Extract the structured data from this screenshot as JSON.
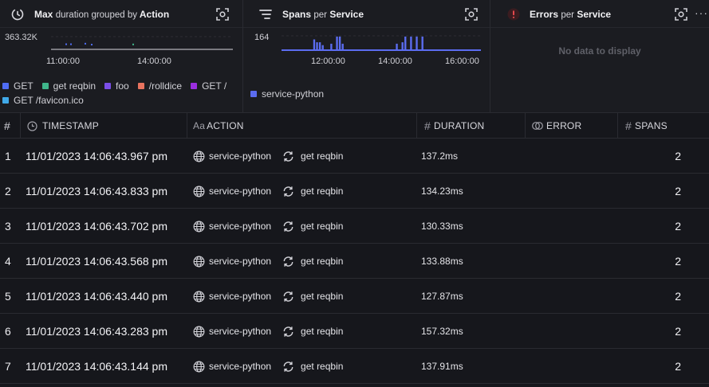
{
  "panels": [
    {
      "title_bold": "Max",
      "title_light": "duration grouped by",
      "title_bold2": "Action",
      "chart_data": {
        "type": "scatter",
        "title": "Max duration grouped by Action",
        "y_tick_labels": [
          "363.32K"
        ],
        "x_tick_labels": [
          "11:00:00",
          "14:00:00"
        ],
        "series": [
          {
            "name": "GET",
            "color": "#4f6df5",
            "points": [
              [
                0.0,
                0.12
              ],
              [
                0.03,
                0.12
              ],
              [
                0.12,
                0.18
              ],
              [
                0.16,
                0.08
              ]
            ]
          },
          {
            "name": "get reqbin",
            "color": "#3fb68b",
            "points": [
              [
                0.42,
                0.1
              ]
            ]
          },
          {
            "name": "foo",
            "color": "#7b4ee8",
            "points": []
          },
          {
            "name": "/rolldice",
            "color": "#e8735f",
            "points": []
          },
          {
            "name": "GET /",
            "color": "#9b2ee0",
            "points": []
          },
          {
            "name": "GET /favicon.ico",
            "color": "#40a9e8",
            "points": []
          }
        ],
        "grid": true,
        "legend": "bottom"
      }
    },
    {
      "title_bold": "Spans",
      "title_light": "per",
      "title_bold2": "Service",
      "chart_data": {
        "type": "bar",
        "title": "Spans per Service",
        "y_tick_labels": [
          "164"
        ],
        "x_tick_labels": [
          "12:00:00",
          "14:00:00",
          "16:00:00"
        ],
        "series": [
          {
            "name": "service-python",
            "color": "#5b6cf0",
            "values": [
              0,
              0,
              0,
              0,
              0,
              0,
              0,
              0,
              0,
              0,
              0,
              0.75,
              0.55,
              0.55,
              0.35,
              0.0,
              0.0,
              0.45,
              0.0,
              0.95,
              0.95,
              0.45,
              0,
              0,
              0,
              0,
              0,
              0,
              0,
              0,
              0,
              0,
              0,
              0,
              0,
              0,
              0,
              0,
              0,
              0.0,
              0.45,
              0,
              0.55,
              0.95,
              0,
              0.95,
              0,
              0.95,
              0,
              0.95,
              0,
              0,
              0,
              0,
              0,
              0,
              0,
              0,
              0,
              0,
              0,
              0,
              0,
              0,
              0,
              0,
              0,
              0,
              0,
              0
            ]
          }
        ],
        "grid": true,
        "legend": "bottom"
      }
    },
    {
      "title_bold": "Errors",
      "title_light": "per",
      "title_bold2": "Service",
      "empty_text": "No data to display",
      "more_label": "···"
    }
  ],
  "table": {
    "columns": [
      {
        "label": "#",
        "icon": "hash-icon"
      },
      {
        "label": "TIMESTAMP",
        "icon": "clock-icon"
      },
      {
        "label": "ACTION",
        "icon": "text-type-icon"
      },
      {
        "label": "DURATION",
        "icon": "hash-icon"
      },
      {
        "label": "ERROR",
        "icon": "error-toggle-icon"
      },
      {
        "label": "SPANS",
        "icon": "hash-icon"
      }
    ],
    "rows": [
      {
        "idx": "1",
        "timestamp": "11/01/2023 14:06:43.967 pm",
        "service": "service-python",
        "action": "get reqbin",
        "duration": "137.2ms",
        "spans": "2"
      },
      {
        "idx": "2",
        "timestamp": "11/01/2023 14:06:43.833 pm",
        "service": "service-python",
        "action": "get reqbin",
        "duration": "134.23ms",
        "spans": "2"
      },
      {
        "idx": "3",
        "timestamp": "11/01/2023 14:06:43.702 pm",
        "service": "service-python",
        "action": "get reqbin",
        "duration": "130.33ms",
        "spans": "2"
      },
      {
        "idx": "4",
        "timestamp": "11/01/2023 14:06:43.568 pm",
        "service": "service-python",
        "action": "get reqbin",
        "duration": "133.88ms",
        "spans": "2"
      },
      {
        "idx": "5",
        "timestamp": "11/01/2023 14:06:43.440 pm",
        "service": "service-python",
        "action": "get reqbin",
        "duration": "127.87ms",
        "spans": "2"
      },
      {
        "idx": "6",
        "timestamp": "11/01/2023 14:06:43.283 pm",
        "service": "service-python",
        "action": "get reqbin",
        "duration": "157.32ms",
        "spans": "2"
      },
      {
        "idx": "7",
        "timestamp": "11/01/2023 14:06:43.144 pm",
        "service": "service-python",
        "action": "get reqbin",
        "duration": "137.91ms",
        "spans": "2"
      }
    ]
  },
  "colors": {
    "background": "#16171c",
    "panel": "#1b1c21",
    "border": "#2a2b31",
    "error_accent": "#e5484d",
    "bar": "#5b6cf0"
  }
}
